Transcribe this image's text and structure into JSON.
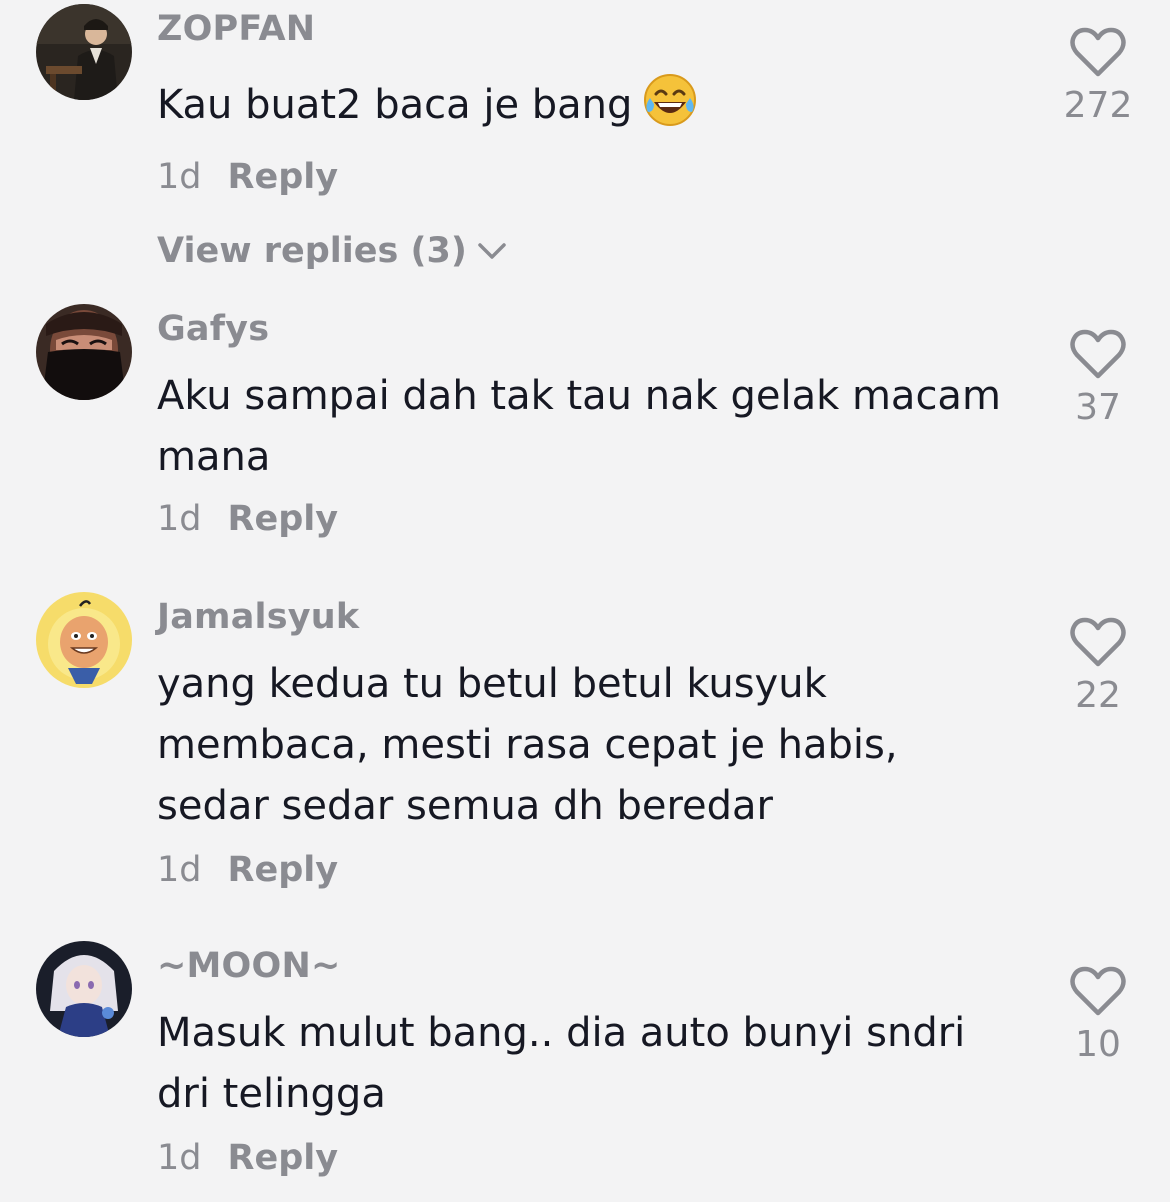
{
  "colors": {
    "background": "#f3f3f4",
    "primary_text": "#161823",
    "secondary_text": "#8a8b91"
  },
  "icons": {
    "like": "heart-outline-icon",
    "expand": "chevron-down-icon",
    "emoji": "face-with-tears-of-joy-emoji"
  },
  "comments": [
    {
      "username": "ZOPFAN",
      "text": "Kau buat2 baca je bang",
      "emoji": "😂",
      "time": "1d",
      "reply_label": "Reply",
      "likes": "272",
      "view_replies_label": "View replies (3)"
    },
    {
      "username": "Gafys",
      "text": "Aku sampai dah tak tau nak gelak macam mana",
      "time": "1d",
      "reply_label": "Reply",
      "likes": "37"
    },
    {
      "username": "Jamalsyuk",
      "text": "yang kedua tu betul betul kusyuk membaca, mesti rasa cepat je habis, sedar sedar semua dh beredar",
      "time": "1d",
      "reply_label": "Reply",
      "likes": "22"
    },
    {
      "username": "~MOON~",
      "text": "Masuk mulut bang.. dia auto bunyi sndri dri telingga",
      "time": "1d",
      "reply_label": "Reply",
      "likes": "10"
    }
  ]
}
